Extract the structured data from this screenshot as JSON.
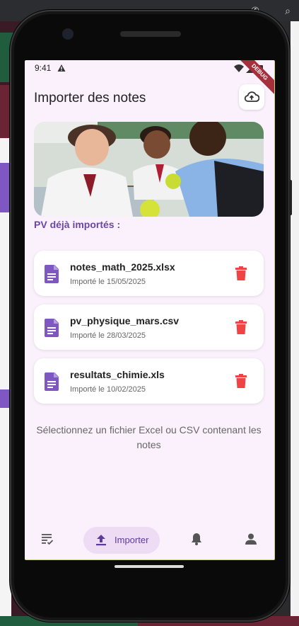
{
  "status_bar": {
    "time": "9:41"
  },
  "debug_banner": "DEBUG",
  "app_bar": {
    "title": "Importer des notes",
    "upload_icon": "cloud-upload-icon"
  },
  "section_title": "PV déjà importés :",
  "files": [
    {
      "name": "notes_math_2025.xlsx",
      "date": "Importé le 15/05/2025"
    },
    {
      "name": "pv_physique_mars.csv",
      "date": "Importé le 28/03/2025"
    },
    {
      "name": "resultats_chimie.xls",
      "date": "Importé le 10/02/2025"
    }
  ],
  "hint": "Sélectionnez un fichier Excel ou CSV contenant les notes",
  "bottom_nav": {
    "items": [
      {
        "icon": "checklist-icon"
      },
      {
        "icon": "upload-icon",
        "label": "Importer",
        "selected": true
      },
      {
        "icon": "bell-icon"
      },
      {
        "icon": "person-icon"
      }
    ]
  },
  "colors": {
    "accent": "#6b46a8",
    "icon_purple": "#7e57c2",
    "delete_red": "#f04444",
    "screen_bg": "#fbf1fc",
    "nav_pill": "#eddcf4"
  }
}
